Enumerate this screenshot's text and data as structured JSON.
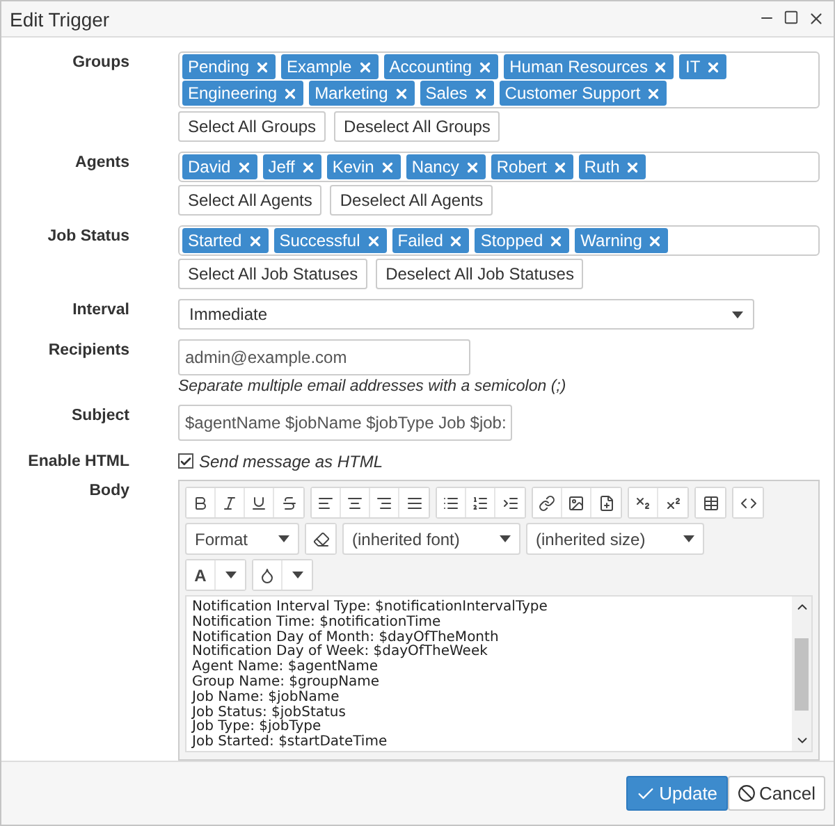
{
  "window": {
    "title": "Edit Trigger"
  },
  "groups": {
    "label": "Groups",
    "tags": [
      "Pending",
      "Example",
      "Accounting",
      "Human Resources",
      "IT",
      "Engineering",
      "Marketing",
      "Sales",
      "Customer Support"
    ],
    "buttons": [
      "Select All Groups",
      "Deselect All Groups"
    ]
  },
  "agents": {
    "label": "Agents",
    "tags": [
      "David",
      "Jeff",
      "Kevin",
      "Nancy",
      "Robert",
      "Ruth"
    ],
    "buttons": [
      "Select All Agents",
      "Deselect All Agents"
    ]
  },
  "job_status": {
    "label": "Job Status",
    "tags": [
      "Started",
      "Successful",
      "Failed",
      "Stopped",
      "Warning"
    ],
    "buttons": [
      "Select All Job Statuses",
      "Deselect All Job Statuses"
    ]
  },
  "interval": {
    "label": "Interval",
    "value": "Immediate"
  },
  "recipients": {
    "label": "Recipients",
    "value": "admin@example.com",
    "hint": "Separate multiple email addresses with a semicolon (;)"
  },
  "subject": {
    "label": "Subject",
    "value": "$agentName $jobName $jobType Job $job:"
  },
  "enable_html": {
    "label": "Enable HTML",
    "checked": true,
    "text": "Send message as HTML"
  },
  "body": {
    "label": "Body",
    "selects": [
      "Format",
      "(inherited font)",
      "(inherited size)"
    ],
    "text_color": "A",
    "lines": [
      "Notification Interval Type: $notificationIntervalType",
      "Notification Time: $notificationTime",
      "Notification Day of Month: $dayOfTheMonth",
      "Notification Day of Week: $dayOfTheWeek",
      "Agent Name: $agentName",
      "Group Name: $groupName",
      "Job Name: $jobName",
      "Job Status: $jobStatus",
      "Job Type: $jobType",
      "Job Started: $startDateTime"
    ]
  },
  "buttons": [
    {
      "label": "Update",
      "kind": "primary"
    },
    {
      "label": "Cancel",
      "kind": "default"
    }
  ]
}
